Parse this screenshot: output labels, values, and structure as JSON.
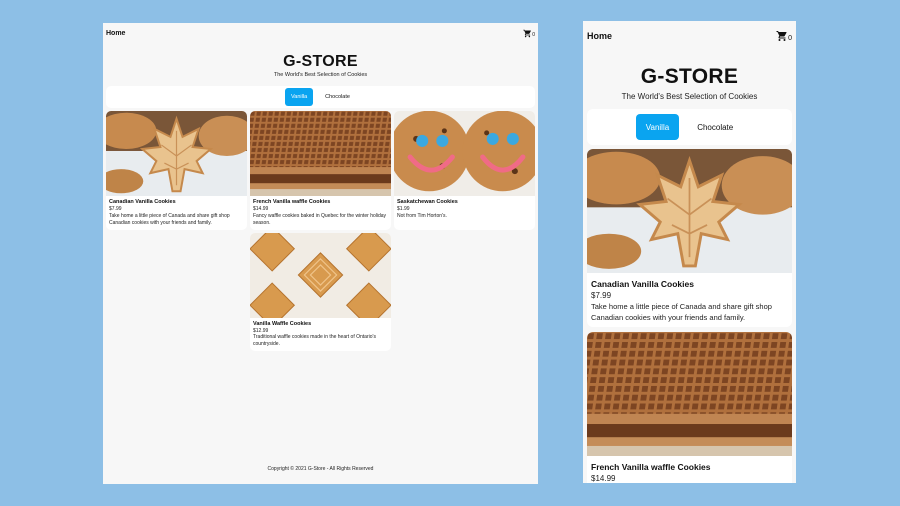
{
  "nav": {
    "home_label": "Home",
    "cart_count": "0"
  },
  "hero": {
    "title": "G-STORE",
    "subtitle": "The World's Best Selection of Cookies"
  },
  "tabs": [
    {
      "label": "Vanilla",
      "active": true
    },
    {
      "label": "Chocolate",
      "active": false
    }
  ],
  "products": [
    {
      "name": "Canadian Vanilla Cookies",
      "price": "$7.99",
      "description": "Take home a little piece of Canada and share gift shop Canadian cookies with your friends and family.",
      "image_icon": "maple-leaf-cookie-image"
    },
    {
      "name": "French Vanilla waffle Cookies",
      "price": "$14.99",
      "description": "Fancy waffle cookies baked in Quebec for the winter holiday season.",
      "image_icon": "stroopwafel-image"
    },
    {
      "name": "Saskatchewan Cookies",
      "price": "$1.99",
      "description": "Not from Tim Horton's.",
      "image_icon": "smiley-cookie-image"
    },
    {
      "name": "Vanilla Waffle Cookies",
      "price": "$12.99",
      "description": "Traditional waffle cookies made in the heart of Ontario's countryside.",
      "image_icon": "waffle-cookie-image"
    }
  ],
  "footer": {
    "copyright": "Copyright © 2021 G-Store - All Rights Reserved"
  },
  "colors": {
    "background": "#8dbfe6",
    "accent": "#0aa4f0",
    "surface": "#f7f7f7"
  }
}
